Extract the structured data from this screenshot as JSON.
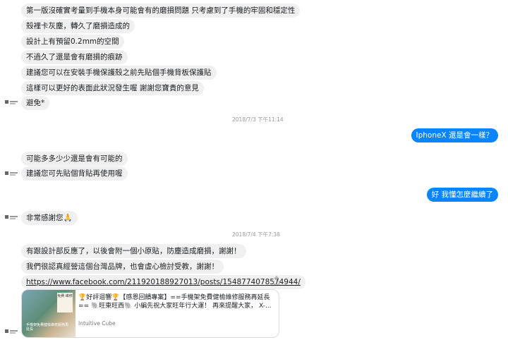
{
  "messages": {
    "m1": "第一版沒確實考量到手機本身可能會有的磨損問題 只考慮到了手機的牢固和穩定性",
    "m2": "殼裡卡灰塵，轉久了磨損造成的",
    "m3": "設計上有預留0.2mm的空間",
    "m4": "不過久了還是會有磨損的痕跡",
    "m5": "建議您可以在安裝手機保護殼之前先貼個手機背板保護貼",
    "m6": "這樣可以更好的表面此狀況發生喔 謝謝您寶貴的意見",
    "m7": "避免*",
    "ts1": "2018/7/3 下午11:14",
    "mine1": "IphoneX 還是會一樣？",
    "m8": "可能多多少少還是會有可能的",
    "m9": "建議您可先貼個背貼再使用喔",
    "mine2": "好 我懂怎麼繼續了",
    "m10": "非常感謝您🙏",
    "ts2": "2018/7/4 下午7:38",
    "m11": "有跟設計部反應了，以後會附一個小原貼，防塵造成磨損，謝謝！",
    "m12": "我們很認真經營這個台灣品牌，也會虛心檢討受教，謝謝！",
    "link": "https://www.facebook.com/211920188927013/posts/1548774078574944/"
  },
  "card": {
    "thumb_badge": "免費 維修",
    "thumb_caption": "手機架免費健檢維修服務再延長",
    "text": "🏆好評迴響🏆【感恩回饋專案】==手機架免費健檢維修服務再延長== 🐘旺東旺西🐘 小編先祝大家旺年行大運！ 再來提醒大家， X-...",
    "source": "Intuitive Cube"
  },
  "colors": {
    "accent": "#0a84ff",
    "bubble": "#f0f0f0"
  }
}
